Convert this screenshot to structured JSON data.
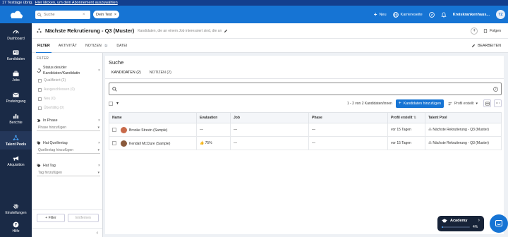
{
  "trial_bar": {
    "days_text": "17 Testtage übrig.",
    "link_text": "Hier klicken, um dein Abonnement auszuwählen"
  },
  "topbar": {
    "search_placeholder": "Suche",
    "pill_label": "Dein Test",
    "new_label": "Neu",
    "career_label": "Karriereseite",
    "company_label": "Kreiskrankenhaus...",
    "avatar_initials": "TZ"
  },
  "sidebar": {
    "items": [
      {
        "label": "Dashboard",
        "icon": "gauge-icon"
      },
      {
        "label": "Kandidaten",
        "icon": "candidates-icon"
      },
      {
        "label": "Jobs",
        "icon": "briefcase-icon"
      },
      {
        "label": "Posteingang",
        "icon": "inbox-icon"
      },
      {
        "label": "Berichte",
        "icon": "reports-icon"
      },
      {
        "label": "Talent Pools",
        "icon": "talent-pools-icon",
        "active": true
      },
      {
        "label": "Akquisition",
        "icon": "megaphone-icon"
      }
    ],
    "settings_label": "Einstellungen",
    "help_label": "Hilfe"
  },
  "header": {
    "title": "Nächste Rekrutierung - Q3 (Muster)",
    "description": "Kandidaten, die an einem Job interessiert sind, die an",
    "follow_label": "Folgen"
  },
  "tabs": [
    {
      "label": "FILTER",
      "active": true
    },
    {
      "label": "AKTIVITÄT"
    },
    {
      "label": "NOTIZEN",
      "count": "1"
    },
    {
      "label": "DATEI"
    }
  ],
  "edit_label": "BEARBEITEN",
  "filter": {
    "heading": "FILTER",
    "status_title": "Status des/der Kandidaten/Kandidatin",
    "status_options": [
      "Qualifiziert (2)",
      "Ausgeschlossen (0)",
      "Neu (0)",
      "Überfällig (0)"
    ],
    "phase_title": "In Phase",
    "phase_placeholder": "Phase hinzufügen",
    "source_title": "Hat Quellentag",
    "source_placeholder": "Quellentag hinzufügen",
    "tag_title": "Hat Tag",
    "tag_placeholder": "Tag hinzufügen",
    "add_filter_label": "+ Filter",
    "remove_label": "Entfernen"
  },
  "search_panel": {
    "title": "Suche",
    "subtabs": [
      "KANDIDATEN (2)",
      "NOTIZEN (2)"
    ],
    "pagination": "1 - 2 von 2 Kandidaten/innen",
    "add_candidates_label": "Kandidaten hinzufügen",
    "sort_label": "Profil erstellt"
  },
  "table": {
    "columns": [
      "Name",
      "Evaluation",
      "Job",
      "Phase",
      "Profil erstellt",
      "Talent Pool"
    ],
    "rows": [
      {
        "name": "Brooke Strexin (Sample)",
        "evaluation": "—",
        "job": "—",
        "phase": "—",
        "created": "vor 15 Tagen",
        "pool": "Nächste Rekrutierung - Q3 (Muster)"
      },
      {
        "name": "Kendall McClure (Sample)",
        "evaluation": "75%",
        "job": "—",
        "phase": "—",
        "created": "vor 15 Tagen",
        "pool": "Nächste Rekrutierung - Q3 (Muster)"
      }
    ]
  },
  "academy": {
    "label": "Academy",
    "progress_label": "4%",
    "progress": 0.04
  },
  "colors": {
    "primary": "#1674d4",
    "sidebar": "#1a2a46",
    "trial_bar": "#133f8e"
  }
}
